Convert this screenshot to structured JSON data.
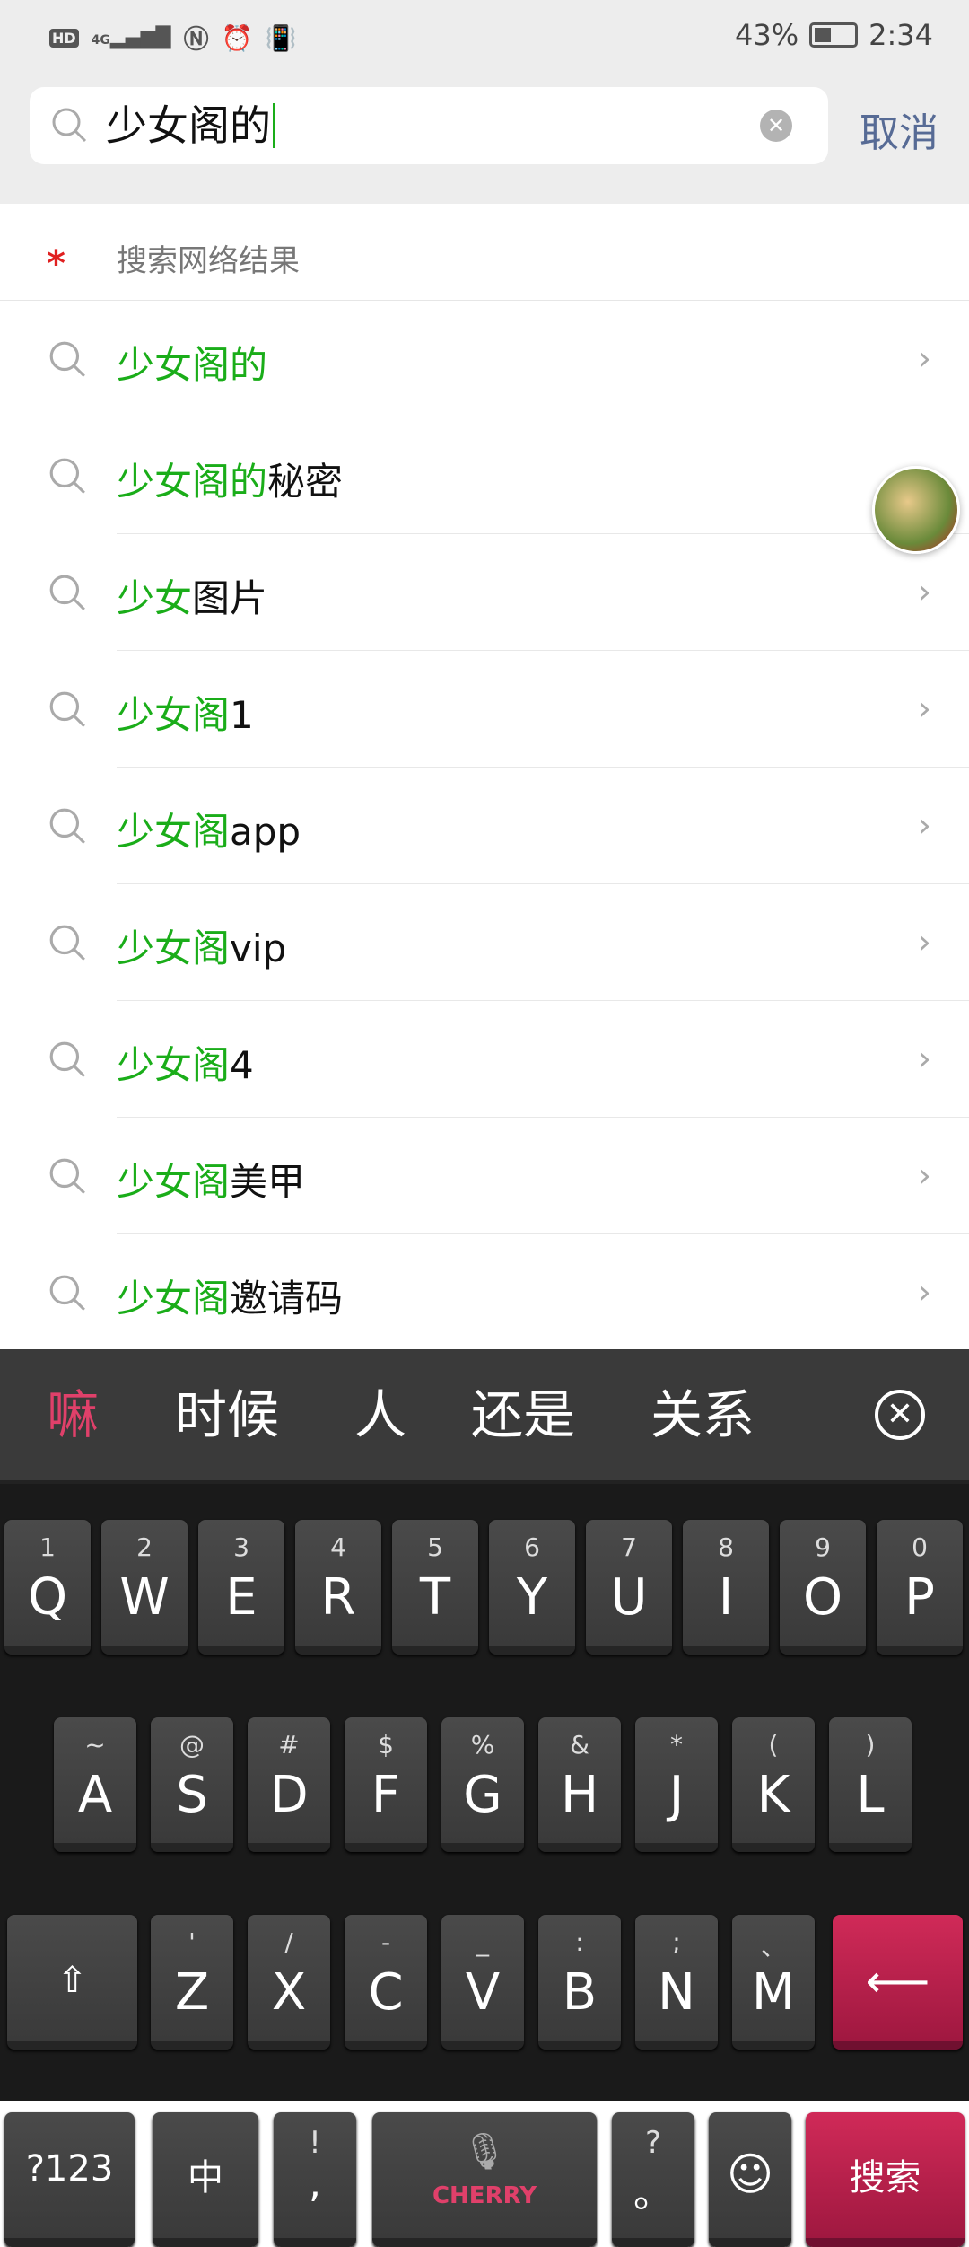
{
  "status": {
    "left_icons": [
      "hd-icon",
      "4g-signal-icon",
      "nfc-icon",
      "alarm-icon",
      "vibrate-icon"
    ],
    "hd": "HD",
    "net": "4G",
    "battery": "43%",
    "time": "2:34"
  },
  "search": {
    "value": "少女阁的",
    "cancel": "取消"
  },
  "section_header": "搜索网络结果",
  "suggestions": [
    {
      "hl": "少女阁的",
      "rest": ""
    },
    {
      "hl": "少女阁的",
      "rest": "秘密"
    },
    {
      "hl": "少女",
      "rest": "图片"
    },
    {
      "hl": "少女阁",
      "rest": "1"
    },
    {
      "hl": "少女阁",
      "rest": "app"
    },
    {
      "hl": "少女阁",
      "rest": "vip"
    },
    {
      "hl": "少女阁",
      "rest": "4"
    },
    {
      "hl": "少女阁",
      "rest": "美甲"
    },
    {
      "hl": "少女阁",
      "rest": "邀请码"
    }
  ],
  "keyboard": {
    "candidates": [
      "嘛",
      "时候",
      "人",
      "还是",
      "关系"
    ],
    "row1": [
      [
        "1",
        "Q"
      ],
      [
        "2",
        "W"
      ],
      [
        "3",
        "E"
      ],
      [
        "4",
        "R"
      ],
      [
        "5",
        "T"
      ],
      [
        "6",
        "Y"
      ],
      [
        "7",
        "U"
      ],
      [
        "8",
        "I"
      ],
      [
        "9",
        "O"
      ],
      [
        "0",
        "P"
      ]
    ],
    "row2": [
      [
        "~",
        "A"
      ],
      [
        "@",
        "S"
      ],
      [
        "#",
        "D"
      ],
      [
        "$",
        "F"
      ],
      [
        "%",
        "G"
      ],
      [
        "&",
        "H"
      ],
      [
        "*",
        "J"
      ],
      [
        "(",
        "K"
      ],
      [
        ")",
        "L"
      ]
    ],
    "row3": [
      [
        "'",
        "Z"
      ],
      [
        "/",
        "X"
      ],
      [
        "-",
        "C"
      ],
      [
        "_",
        "V"
      ],
      [
        ":",
        "B"
      ],
      [
        ";",
        "N"
      ],
      [
        "、",
        "M"
      ]
    ],
    "sym": "?123",
    "lang": "中",
    "punct1": [
      "!",
      ","
    ],
    "punct2": [
      "?",
      "。"
    ],
    "brand": "CHERRY",
    "enter": "搜索",
    "accent": "#c8204c"
  }
}
